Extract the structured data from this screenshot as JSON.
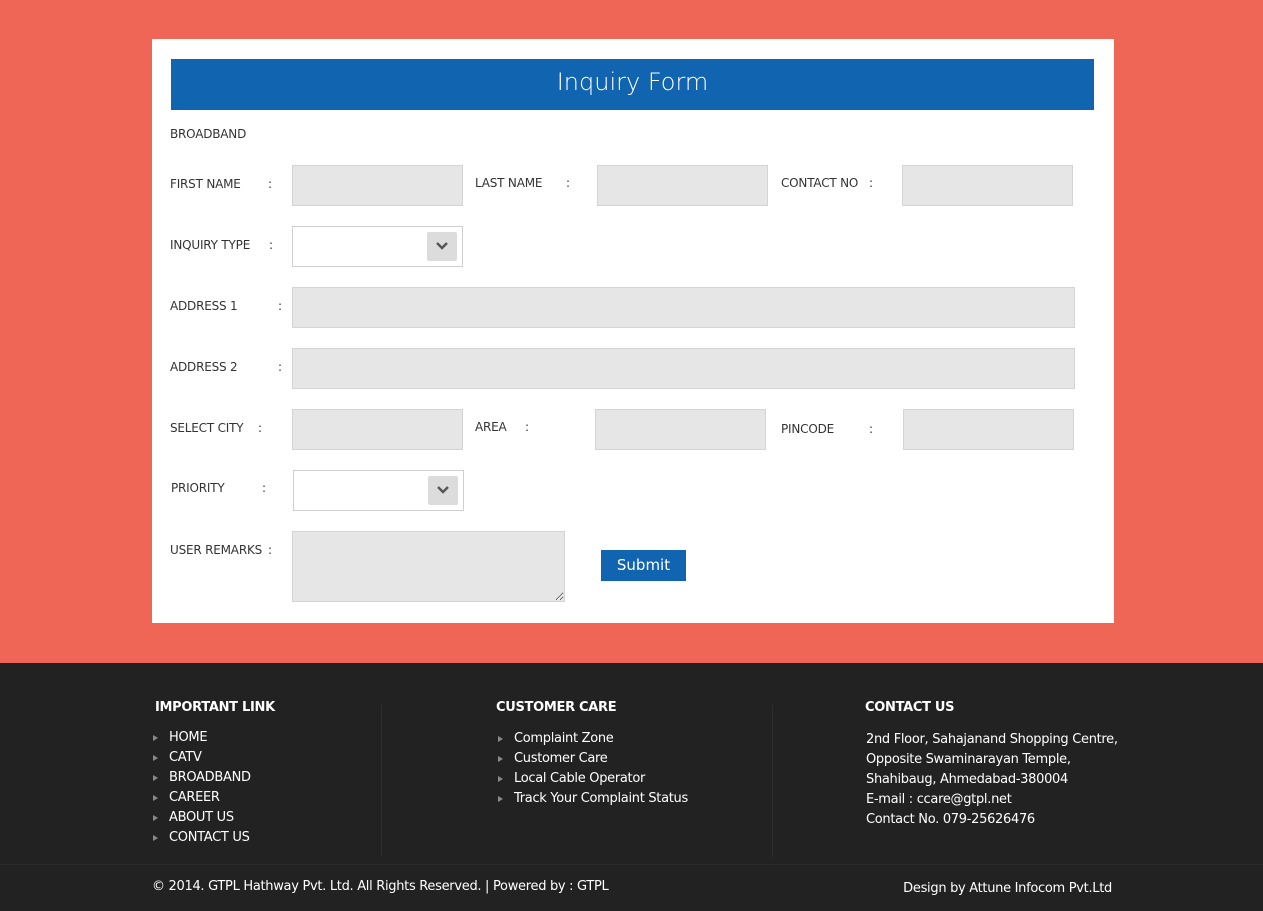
{
  "form": {
    "title": "Inquiry Form",
    "section_label": "BROADBAND",
    "colon": ":",
    "fields": {
      "first_name": {
        "label": "FIRST NAME",
        "value": ""
      },
      "last_name": {
        "label": "LAST NAME",
        "value": ""
      },
      "contact_no": {
        "label": "CONTACT NO",
        "value": ""
      },
      "inquiry_type": {
        "label": "INQUIRY TYPE",
        "selected": ""
      },
      "address1": {
        "label": "ADDRESS 1",
        "value": ""
      },
      "address2": {
        "label": "ADDRESS 2",
        "value": ""
      },
      "select_city": {
        "label": "SELECT CITY",
        "value": ""
      },
      "area": {
        "label": "AREA",
        "value": ""
      },
      "pincode": {
        "label": "PINCODE",
        "value": ""
      },
      "priority": {
        "label": "PRIORITY",
        "selected": ""
      },
      "user_remarks": {
        "label": "USER REMARKS",
        "value": ""
      }
    },
    "submit_label": "Submit"
  },
  "footer": {
    "important_link": {
      "heading": "IMPORTANT LINK",
      "items": [
        "HOME",
        "CATV",
        "BROADBAND",
        "CAREER",
        "ABOUT US",
        "CONTACT US"
      ]
    },
    "customer_care": {
      "heading": "CUSTOMER CARE",
      "items": [
        "Complaint Zone",
        "Customer Care",
        "Local Cable Operator",
        "Track Your Complaint Status"
      ]
    },
    "contact_us": {
      "heading": "CONTACT US",
      "lines": [
        "2nd Floor, Sahajanand Shopping Centre,",
        "Opposite Swaminarayan Temple,",
        "Shahibaug, Ahmedabad-380004",
        "E-mail :  ccare@gtpl.net",
        "Contact No. 079-25626476"
      ]
    },
    "copyright": "© 2014. GTPL Hathway Pvt. Ltd. All Rights Reserved. | Powered by : GTPL",
    "design_by": "Design by Attune Infocom Pvt.Ltd"
  },
  "colors": {
    "top_band": "#EF6656",
    "title_bar": "#1164B0",
    "input_bg": "#E6E6E6",
    "footer_bg": "#222222"
  },
  "icons": {
    "select_arrow": "chevron-down-icon",
    "list_bullet": "triangle-right-icon"
  }
}
